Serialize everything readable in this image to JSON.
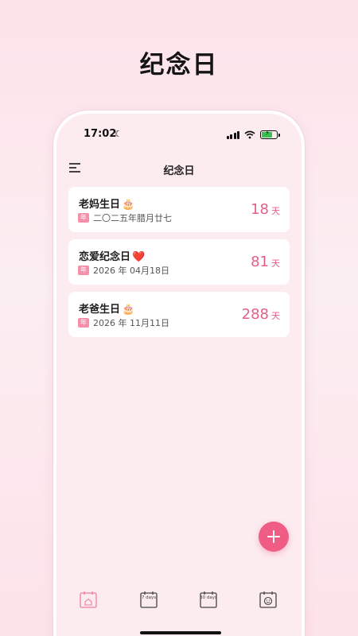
{
  "promo": {
    "title": "纪念日"
  },
  "status_bar": {
    "time": "17:02",
    "moon": "☾"
  },
  "nav": {
    "title": "纪念日"
  },
  "anniversaries": [
    {
      "name": "老妈生日",
      "emoji": "🎂",
      "badge": "年",
      "date": "二〇二五年腊月廿七",
      "count": "18",
      "unit": "天"
    },
    {
      "name": "恋爱纪念日",
      "emoji": "❤️",
      "badge": "年",
      "date": "2026 年 04月18日",
      "count": "81",
      "unit": "天"
    },
    {
      "name": "老爸生日",
      "emoji": "🎂",
      "badge": "年",
      "date": "2026 年 11月11日",
      "count": "288",
      "unit": "天"
    }
  ],
  "tabs": [
    {
      "icon": "home-calendar-icon",
      "label": "",
      "active": true
    },
    {
      "icon": "calendar-7days-icon",
      "label": "7 days",
      "active": false
    },
    {
      "icon": "calendar-30days-icon",
      "label": "30 days",
      "active": false
    },
    {
      "icon": "calendar-smile-icon",
      "label": "",
      "active": false
    }
  ],
  "colors": {
    "accent": "#ef5d85",
    "count_text": "#e65d86",
    "badge_bg": "#f590ab",
    "screen_bg": "#fcecef"
  }
}
